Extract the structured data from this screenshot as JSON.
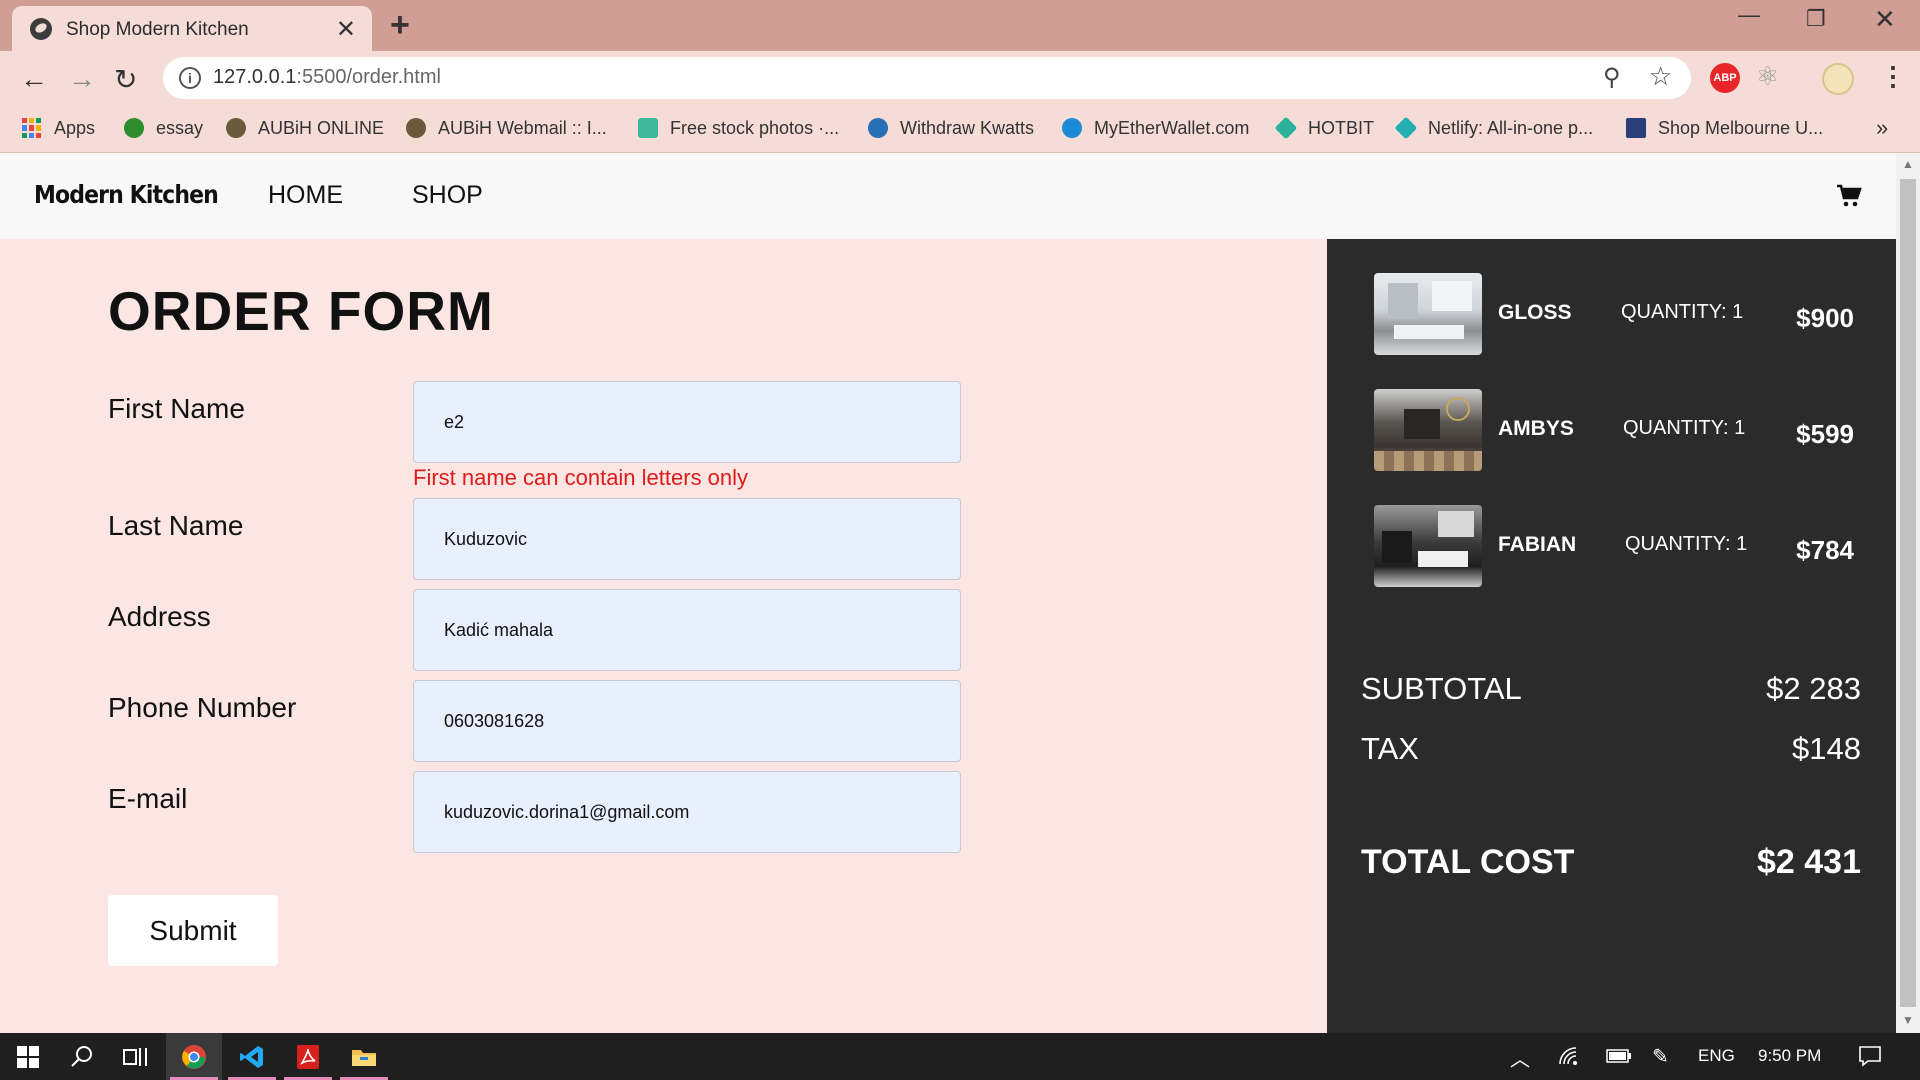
{
  "browser": {
    "tab_title": "Shop Modern Kitchen",
    "url_host": "127.0.0.1",
    "url_rest": ":5500/order.html",
    "bookmarks": [
      {
        "label": "Apps",
        "icon": "apps-grid-icon",
        "color": "#e8453c"
      },
      {
        "label": "essay",
        "icon": "essay-favicon",
        "color": "#2e8b2e"
      },
      {
        "label": "AUBiH ONLINE",
        "icon": "aubih-favicon",
        "color": "#6b5a3a"
      },
      {
        "label": "AUBiH Webmail :: I...",
        "icon": "aubih-webmail-favicon",
        "color": "#6b5a3a"
      },
      {
        "label": "Free stock photos ·...",
        "icon": "pexels-favicon",
        "color": "#3fb89a"
      },
      {
        "label": "Withdraw Kwatts",
        "icon": "kwatts-favicon",
        "color": "#2a6fb5"
      },
      {
        "label": "MyEtherWallet.com",
        "icon": "myetherwallet-favicon",
        "color": "#1e8ad8"
      },
      {
        "label": "HOTBIT",
        "icon": "hotbit-favicon",
        "color": "#2bb39a"
      },
      {
        "label": "Netlify: All-in-one p...",
        "icon": "netlify-favicon",
        "color": "#21b0b0"
      },
      {
        "label": "Shop Melbourne U...",
        "icon": "melbourne-favicon",
        "color": "#2a3f7a"
      }
    ],
    "more_bookmarks": "»",
    "ext_abp": "ABP"
  },
  "site": {
    "brand": "Modern Kitchen",
    "nav": {
      "home": "HOME",
      "shop": "SHOP"
    }
  },
  "form": {
    "title": "ORDER FORM",
    "fields": {
      "first_name": {
        "label": "First Name",
        "value": "e2"
      },
      "last_name": {
        "label": "Last Name",
        "value": "Kuduzovic"
      },
      "address": {
        "label": "Address",
        "value": "Kadić mahala"
      },
      "phone": {
        "label": "Phone Number",
        "value": "0603081628"
      },
      "email": {
        "label": "E-mail",
        "value": "kuduzovic.dorina1@gmail.com"
      }
    },
    "first_name_error": "First name can contain letters only",
    "submit_label": "Submit"
  },
  "cart": {
    "items": [
      {
        "name": "GLOSS",
        "quantity": "QUANTITY: 1",
        "price": "$900"
      },
      {
        "name": "AMBYS",
        "quantity": "QUANTITY: 1",
        "price": "$599"
      },
      {
        "name": "FABIAN",
        "quantity": "QUANTITY: 1",
        "price": "$784"
      }
    ],
    "subtotal_label": "SUBTOTAL",
    "subtotal_value": "$2 283",
    "tax_label": "TAX",
    "tax_value": "$148",
    "total_label": "TOTAL COST",
    "total_value": "$2 431"
  },
  "taskbar": {
    "language": "ENG",
    "time": "9:50 PM"
  },
  "colors": {
    "tab_bar": "#d19e96",
    "chrome_bg": "#f6dcd7",
    "page_bg": "#fbe6e3",
    "summary_bg": "#2b2b2b",
    "input_bg": "#e8f0fe",
    "error": "#e01b1b"
  }
}
